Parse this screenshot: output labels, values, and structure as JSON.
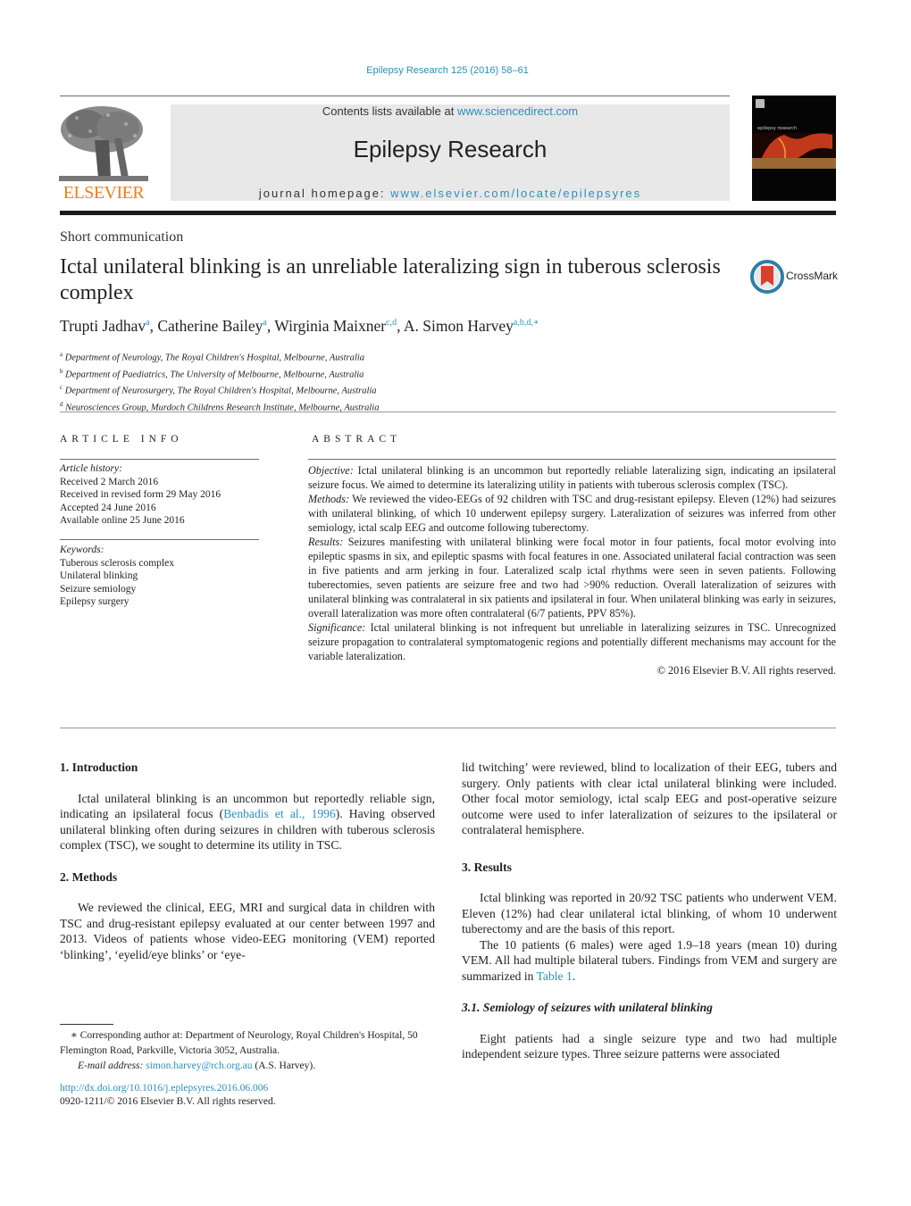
{
  "header": {
    "citation": "Epilepsy Research 125 (2016) 58–61",
    "contents_prefix": "Contents lists available at ",
    "contents_link": "www.sciencedirect.com",
    "journal_name": "Epilepsy Research",
    "homepage_prefix": "journal homepage: ",
    "homepage_link": "www.elsevier.com/locate/epilepsyres",
    "publisher_logo_text": "ELSEVIER",
    "cover_title": "epilepsy research",
    "crossmark_label": "CrossMark"
  },
  "colors": {
    "link": "#2a8fbd",
    "elsevier_orange": "#f07d1a",
    "masthead_gray": "#e8e8e8",
    "crossmark_red": "#d9402c",
    "crossmark_ring": "#2c7fa9"
  },
  "article": {
    "type": "Short communication",
    "title": "Ictal unilateral blinking is an unreliable lateralizing sign in tuberous sclerosis complex",
    "authors": [
      {
        "name": "Trupti Jadhav",
        "sup": "a"
      },
      {
        "name": "Catherine Bailey",
        "sup": "a"
      },
      {
        "name": "Wirginia Maixner",
        "sup": "c,d"
      },
      {
        "name": "A. Simon Harvey",
        "sup": "a,b,d,∗"
      }
    ],
    "affiliations": [
      {
        "sup": "a",
        "text": "Department of Neurology, The Royal Children's Hospital, Melbourne, Australia"
      },
      {
        "sup": "b",
        "text": "Department of Paediatrics, The University of Melbourne, Melbourne, Australia"
      },
      {
        "sup": "c",
        "text": "Department of Neurosurgery, The Royal Children's Hospital, Melbourne, Australia"
      },
      {
        "sup": "d",
        "text": "Neurosciences Group, Murdoch Childrens Research Institute, Melbourne, Australia"
      }
    ]
  },
  "article_info": {
    "heading": "ARTICLE INFO",
    "history_label": "Article history:",
    "history": [
      "Received 2 March 2016",
      "Received in revised form 29 May 2016",
      "Accepted 24 June 2016",
      "Available online 25 June 2016"
    ],
    "keywords_label": "Keywords:",
    "keywords": [
      "Tuberous sclerosis complex",
      "Unilateral blinking",
      "Seizure semiology",
      "Epilepsy surgery"
    ]
  },
  "abstract": {
    "heading": "ABSTRACT",
    "sections": [
      {
        "label": "Objective:",
        "text": " Ictal unilateral blinking is an uncommon but reportedly reliable lateralizing sign, indicating an ipsilateral seizure focus. We aimed to determine its lateralizing utility in patients with tuberous sclerosis complex (TSC)."
      },
      {
        "label": "Methods:",
        "text": " We reviewed the video-EEGs of 92 children with TSC and drug-resistant epilepsy. Eleven (12%) had seizures with unilateral blinking, of which 10 underwent epilepsy surgery. Lateralization of seizures was inferred from other semiology, ictal scalp EEG and outcome following tuberectomy."
      },
      {
        "label": "Results:",
        "text": " Seizures manifesting with unilateral blinking were focal motor in four patients, focal motor evolving into epileptic spasms in six, and epileptic spasms with focal features in one. Associated unilateral facial contraction was seen in five patients and arm jerking in four. Lateralized scalp ictal rhythms were seen in seven patients. Following tuberectomies, seven patients are seizure free and two had >90% reduction. Overall lateralization of seizures with unilateral blinking was contralateral in six patients and ipsilateral in four. When unilateral blinking was early in seizures, overall lateralization was more often contralateral (6/7 patients, PPV 85%)."
      },
      {
        "label": "Significance:",
        "text": " Ictal unilateral blinking is not infrequent but unreliable in lateralizing seizures in TSC. Unrecognized seizure propagation to contralateral symptomatogenic regions and potentially different mechanisms may account for the variable lateralization."
      }
    ],
    "copyright": "© 2016 Elsevier B.V. All rights reserved."
  },
  "body": {
    "intro_heading": "1.  Introduction",
    "intro_text_pre": "Ictal unilateral blinking is an uncommon but reportedly reliable sign, indicating an ipsilateral focus (",
    "intro_cite": "Benbadis et al., 1996",
    "intro_text_post": "). Having observed unilateral blinking often during seizures in children with tuberous sclerosis complex (TSC), we sought to determine its utility in TSC.",
    "methods_heading": "2.  Methods",
    "methods_text": "We reviewed the clinical, EEG, MRI and surgical data in children with TSC and drug-resistant epilepsy evaluated at our center between 1997 and 2013. Videos of patients whose video-EEG monitoring (VEM) reported ‘blinking’, ‘eyelid/eye blinks’ or ‘eye-",
    "methods_cont": "lid twitching’ were reviewed, blind to localization of their EEG, tubers and surgery. Only patients with clear ictal unilateral blinking were included. Other focal motor semiology, ictal scalp EEG and post-operative seizure outcome were used to infer lateralization of seizures to the ipsilateral or contralateral hemisphere.",
    "results_heading": "3.  Results",
    "results_p1": "Ictal blinking was reported in 20/92 TSC patients who underwent VEM. Eleven (12%) had clear unilateral ictal blinking, of whom 10 underwent tuberectomy and are the basis of this report.",
    "results_p2_pre": "The 10 patients (6 males) were aged 1.9–18 years (mean 10) during VEM. All had multiple bilateral tubers. Findings from VEM and surgery are summarized in ",
    "results_p2_link": "Table 1",
    "results_p2_post": ".",
    "subsec_heading": "3.1.  Semiology of seizures with unilateral blinking",
    "subsec_text": "Eight patients had a single seizure type and two had multiple independent seizure types. Three seizure patterns were associated"
  },
  "footnote": {
    "marker": "∗",
    "text": " Corresponding author at: Department of Neurology, Royal Children's Hospital, 50 Flemington Road, Parkville, Victoria 3052, Australia.",
    "email_label": "E-mail address:",
    "email": "simon.harvey@rch.org.au",
    "email_suffix": " (A.S. Harvey).",
    "doi": "http://dx.doi.org/10.1016/j.eplepsyres.2016.06.006",
    "issn_copyright": "0920-1211/© 2016 Elsevier B.V. All rights reserved."
  }
}
